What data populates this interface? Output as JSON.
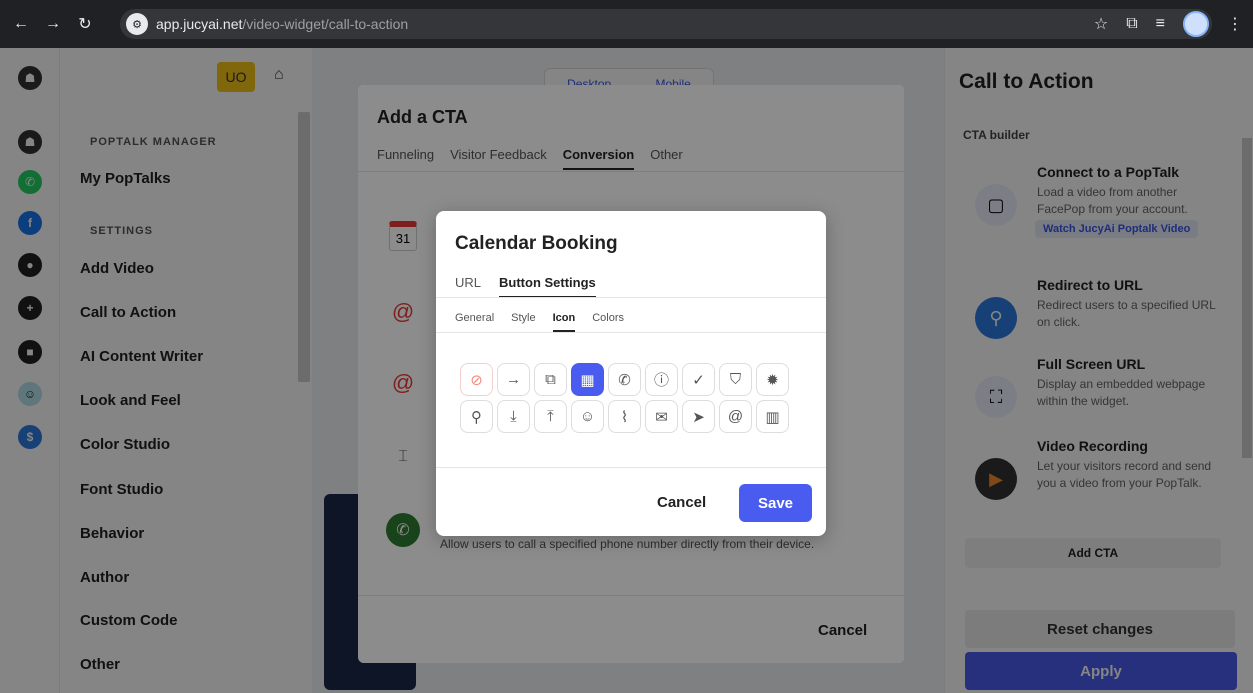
{
  "browser": {
    "url_host": "app.jucyai.net",
    "url_path": "/video-widget/call-to-action"
  },
  "sidebar": {
    "user_initials": "UO",
    "section_manager": "POPTALK MANAGER",
    "my_poptalks": "My PopTalks",
    "section_settings": "SETTINGS",
    "items": [
      {
        "label": "Add Video"
      },
      {
        "label": "Call to Action"
      },
      {
        "label": "AI Content Writer"
      },
      {
        "label": "Look and Feel"
      },
      {
        "label": "Color Studio"
      },
      {
        "label": "Font Studio"
      },
      {
        "label": "Behavior"
      },
      {
        "label": "Author"
      },
      {
        "label": "Custom Code"
      },
      {
        "label": "Other"
      }
    ]
  },
  "main": {
    "view_toggle": {
      "desktop": "Desktop",
      "mobile": "Mobile"
    }
  },
  "right_panel": {
    "title": "Call to Action",
    "builder_label": "CTA builder",
    "cards": [
      {
        "title": "Connect to a PopTalk",
        "desc": "Load a video from another FacePop from your account.",
        "link": "Watch JucyAi Poptalk Video"
      },
      {
        "title": "Redirect to URL",
        "desc": "Redirect users to a specified URL on click."
      },
      {
        "title": "Full Screen URL",
        "desc": "Display an embedded webpage within the widget."
      },
      {
        "title": "Video Recording",
        "desc": "Let your visitors record and send you a video from your PopTalk."
      }
    ],
    "add_cta": "Add CTA",
    "reset": "Reset changes",
    "apply": "Apply"
  },
  "cta_modal": {
    "title": "Add a CTA",
    "tabs": [
      "Funneling",
      "Visitor Feedback",
      "Conversion",
      "Other"
    ],
    "active_tab": "Conversion",
    "calendar_day": "31",
    "phone_desc": "Allow users to call a specified phone number directly from their device.",
    "cancel": "Cancel"
  },
  "calendar_dialog": {
    "title": "Calendar Booking",
    "tabs": [
      "URL",
      "Button Settings"
    ],
    "active_tab": "Button Settings",
    "subtabs": [
      "General",
      "Style",
      "Icon",
      "Colors"
    ],
    "active_subtab": "Icon",
    "icons_row1": [
      "none-icon",
      "arrow-right-icon",
      "external-link-icon",
      "calendar-icon",
      "phone-icon",
      "info-icon",
      "check-icon",
      "shield-check-icon",
      "verified-badge-icon"
    ],
    "icons_row2": [
      "search-icon",
      "download-icon",
      "upload-icon",
      "smile-icon",
      "paperclip-icon",
      "mail-icon",
      "send-icon",
      "at-icon",
      "book-icon"
    ],
    "selected_icon": "calendar-icon",
    "cancel": "Cancel",
    "save": "Save"
  },
  "colors": {
    "accent": "#4a5cf0",
    "chrome_bg": "#202124"
  }
}
